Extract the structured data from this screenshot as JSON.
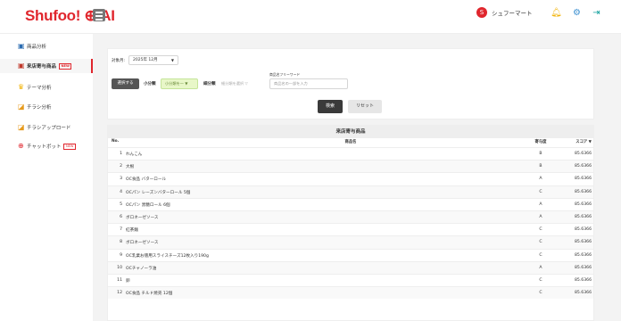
{
  "header": {
    "logo": "Shufoo! ⊕ AI",
    "user_initial": "S",
    "user_name": "シュフーマート",
    "icons": [
      "bell-icon",
      "gear-icon",
      "logout-icon"
    ]
  },
  "sidebar": {
    "items": [
      {
        "label": "商品分析",
        "icon": "product-icon",
        "new": false,
        "active": false
      },
      {
        "label": "来店寄与商品",
        "icon": "store-icon",
        "new": true,
        "active": true
      },
      {
        "label": "テーマ分析",
        "icon": "crown-icon",
        "new": false,
        "active": false
      },
      {
        "label": "チラシ分析",
        "icon": "flyer-icon",
        "new": false,
        "active": false
      },
      {
        "label": "チラシアップロード",
        "icon": "upload-icon",
        "new": false,
        "active": false
      },
      {
        "label": "チャットボット",
        "icon": "chatbot-icon",
        "new": true,
        "active": false
      }
    ],
    "new_label": "NEW"
  },
  "filter": {
    "month_label": "対象月:",
    "month_value": "2025年 12月",
    "select_button": "選択する",
    "small_cat_label": "小分類",
    "small_cat_value": "小分類を一 ▼",
    "detail_cat_label": "細分類",
    "detail_cat_placeholder": "細分類を選択 ▽",
    "free_word_label": "商品名フリーワード",
    "free_word_placeholder": "商品名の一部を入力",
    "search_button": "検索",
    "reset_button": "リセット"
  },
  "table": {
    "title": "来店寄与商品",
    "columns": {
      "no": "No.",
      "name": "商品名",
      "cls": "寄与度",
      "score": "スコア ▼"
    },
    "rows": [
      {
        "no": "1",
        "name": "れんこん",
        "cls": "B",
        "score": "85.6366"
      },
      {
        "no": "2",
        "name": "大根",
        "cls": "B",
        "score": "85.6366"
      },
      {
        "no": "3",
        "name": "OC食品 バターロール",
        "cls": "A",
        "score": "85.6366"
      },
      {
        "no": "4",
        "name": "OCパン レーズンバターロール 5個",
        "cls": "C",
        "score": "85.6366"
      },
      {
        "no": "5",
        "name": "OCパン 黒糖ロール 6個",
        "cls": "A",
        "score": "85.6366"
      },
      {
        "no": "6",
        "name": "ボロネーゼソース",
        "cls": "A",
        "score": "85.6366"
      },
      {
        "no": "7",
        "name": "紅茶麺",
        "cls": "C",
        "score": "85.6366"
      },
      {
        "no": "8",
        "name": "ボロネーゼソース",
        "cls": "C",
        "score": "85.6366"
      },
      {
        "no": "9",
        "name": "OC乳業お徳用スライスチーズ12枚入り190g",
        "cls": "C",
        "score": "85.6366"
      },
      {
        "no": "10",
        "name": "OCチャノーラ油",
        "cls": "A",
        "score": "85.6366"
      },
      {
        "no": "11",
        "name": "卵",
        "cls": "C",
        "score": "85.6366"
      },
      {
        "no": "12",
        "name": "OC食品 チルド焼売 12個",
        "cls": "C",
        "score": "85.6366"
      }
    ]
  }
}
